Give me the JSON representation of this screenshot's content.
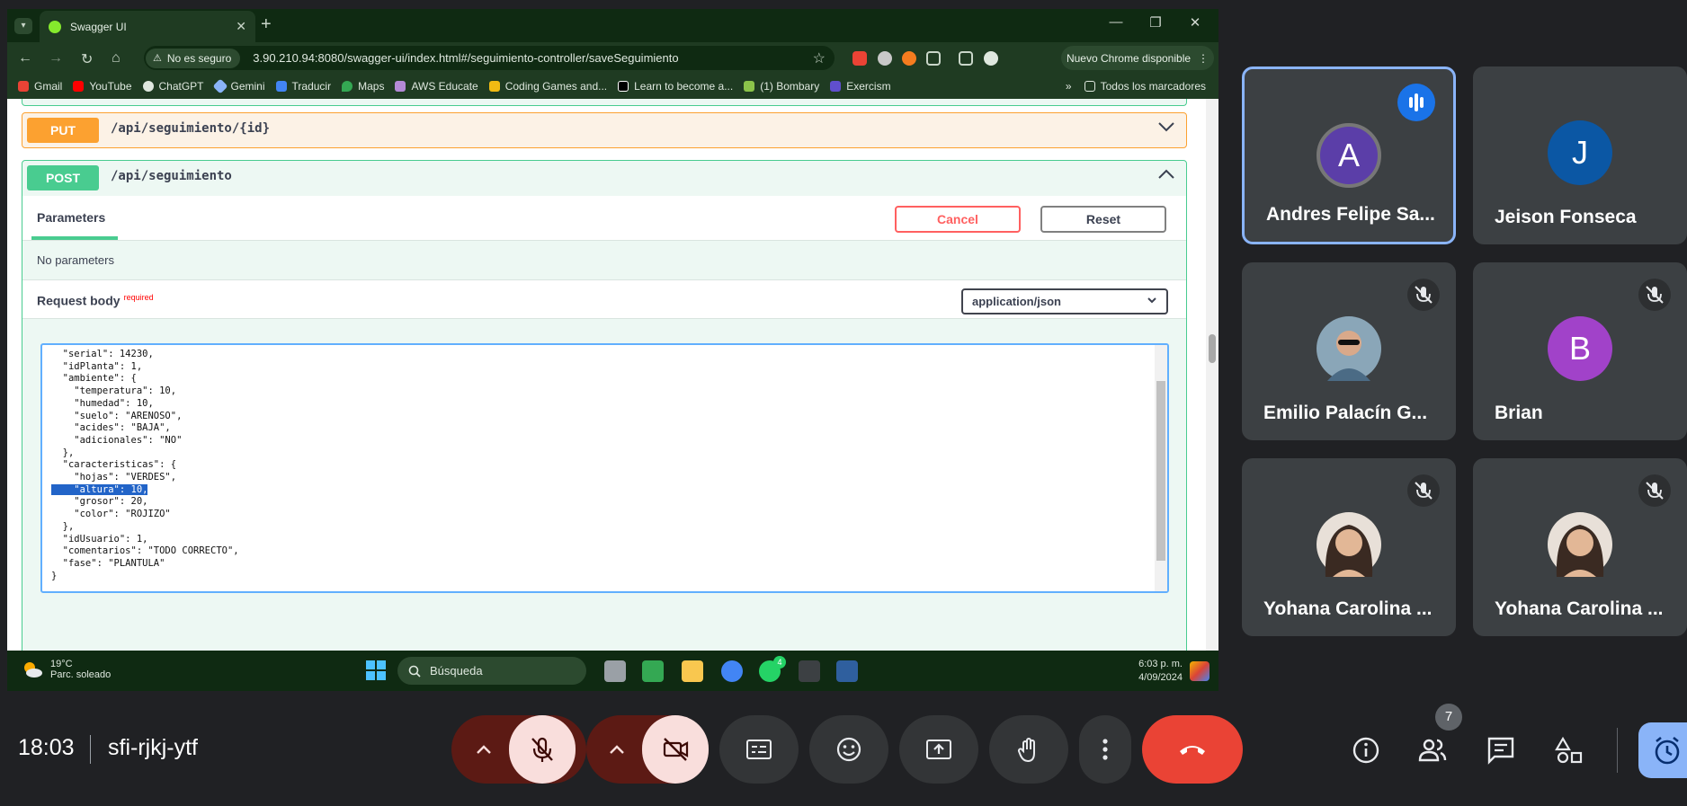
{
  "browser": {
    "tab_title": "Swagger UI",
    "new_tab": "+",
    "security_label": "No es seguro",
    "url": "3.90.210.94:8080/swagger-ui/index.html#/seguimiento-controller/saveSeguimiento",
    "update_label": "Nuevo Chrome disponible",
    "bookmarks": [
      "Gmail",
      "YouTube",
      "ChatGPT",
      "Gemini",
      "Traducir",
      "Maps",
      "AWS Educate",
      "Coding Games and...",
      "Learn to become a...",
      "(1) Bombary",
      "Exercism"
    ],
    "all_bookmarks": "Todos los marcadores",
    "more": "»"
  },
  "swagger": {
    "put": {
      "method": "PUT",
      "path": "/api/seguimiento/{id}"
    },
    "post": {
      "method": "POST",
      "path": "/api/seguimiento"
    },
    "parameters_label": "Parameters",
    "cancel_label": "Cancel",
    "reset_label": "Reset",
    "no_parameters": "No parameters",
    "request_body_label": "Request body",
    "required_label": "required",
    "content_type": "application/json",
    "code_before": "  \"serial\": 14230,\n  \"idPlanta\": 1,\n  \"ambiente\": {\n    \"temperatura\": 10,\n    \"humedad\": 10,\n    \"suelo\": \"ARENOSO\",\n    \"acides\": \"BAJA\",\n    \"adicionales\": \"NO\"\n  },\n  \"caracteristicas\": {\n    \"hojas\": \"VERDES\",\n",
    "code_highlight": "    \"altura\": 10,",
    "code_after": "\n    \"grosor\": 20,\n    \"color\": \"ROJIZO\"\n  },\n  \"idUsuario\": 1,\n  \"comentarios\": \"TODO CORRECTO\",\n  \"fase\": \"PLANTULA\"\n}"
  },
  "taskbar": {
    "temperature": "19°C",
    "weather_desc": "Parc. soleado",
    "search_label": "Búsqueda",
    "time": "6:03 p. m.",
    "date": "4/09/2024",
    "whatsapp_badge": "4"
  },
  "participants": [
    {
      "initial": "A",
      "name": "Andres Felipe Sa...",
      "color": "#5b3ea8"
    },
    {
      "initial": "J",
      "name": "Jeison Fonseca",
      "color": "#0b57a4"
    },
    {
      "initial": "",
      "name": "Emilio Palacín G...",
      "color": "#8aa6b8"
    },
    {
      "initial": "B",
      "name": "Brian",
      "color": "#a142c9"
    },
    {
      "initial": "",
      "name": "Yohana Carolina ...",
      "color": "#5c4a42"
    },
    {
      "initial": "",
      "name": "Yohana Carolina ...",
      "color": "#5c4a42"
    }
  ],
  "meet": {
    "time": "18:03",
    "code": "sfi-rjkj-ytf",
    "participant_count": "7"
  }
}
